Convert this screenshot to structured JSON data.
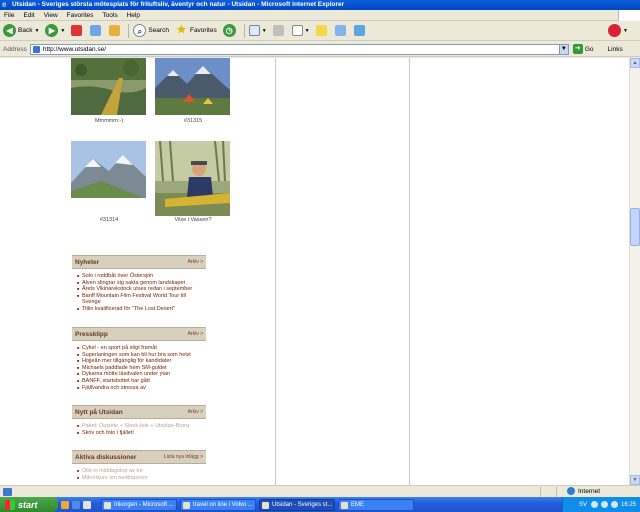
{
  "window": {
    "title": "Utsidan - Sveriges största mötesplats för friluftsliv, äventyr och natur - Utsidan - Microsoft Internet Explorer"
  },
  "menu": [
    "File",
    "Edit",
    "View",
    "Favorites",
    "Tools",
    "Help"
  ],
  "toolbar": {
    "back_label": "Back",
    "search_label": "Search",
    "favorites_label": "Favorites"
  },
  "address": {
    "label": "Address",
    "url": "http://www.utsidan.se/",
    "go_label": "Go",
    "links_label": "Links"
  },
  "photos": [
    {
      "caption": "Mmmmm:-)"
    },
    {
      "caption": "#31315"
    },
    {
      "caption": "#31314"
    },
    {
      "caption": "Vilse i Vassen?"
    }
  ],
  "sections": {
    "news": {
      "title": "Nyheter",
      "more": "Arkiv >",
      "items": [
        "Solo i roddbåt över Östersjön",
        "Alven slingrar sig sakta genom landskapet",
        "Årets Vikinarekstock utses redan i september",
        "Banff Mountain Film Festival World Tour till Sverige",
        "Titlin kvalificerad för \"The Lost Desert\""
      ]
    },
    "press": {
      "title": "Pressklipp",
      "more": "Arkiv >",
      "items": [
        "Cykel - en sport på stigt framåt",
        "Superlaningen som kan bli hur bra som helst",
        "Hojjeån mer tillgänglig för kandidater",
        "Michaels paddlade hem SM-guldet",
        "Dykarna mötte läsdvalen under ytan",
        "BANFF, startsbottet har gått",
        "Fjällvandra och stressa av"
      ]
    },
    "new_on_site": {
      "title": "Nytt på Utsidan",
      "more": "Arkiv >",
      "items": [
        "Paket: Outside + Sleek-bok + Utsidan-Bronz",
        "Skriv och foto i fjället!"
      ]
    },
    "discussions": {
      "title": "Aktiva diskussioner",
      "more": "Lista nya inlägg >",
      "items": [
        "Olle in middagstop av tre",
        "Mikrorkurs om nedbrunnen"
      ]
    }
  },
  "status": {
    "zone": "Internet"
  },
  "taskbar": {
    "start_label": "start",
    "tasks": [
      "Inkorgen - Microsoft ...",
      "travel on line i Volvo ...",
      "Utsidan - Sveriges st...",
      "EME"
    ],
    "lang": "SV",
    "time": "16:25"
  }
}
